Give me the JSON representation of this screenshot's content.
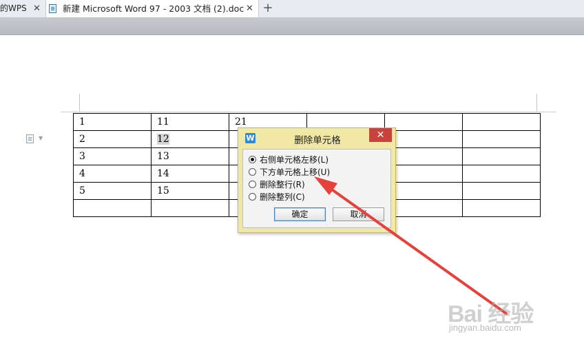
{
  "tabs": {
    "prev_label": "的WPS",
    "active_label": "新建 Microsoft Word 97 - 2003 文档 (2).doc",
    "close_glyph": "✕",
    "new_tab_glyph": "+"
  },
  "table": {
    "rows": [
      [
        "1",
        "11",
        "21",
        "",
        "",
        ""
      ],
      [
        "2",
        "12",
        "",
        "",
        "",
        ""
      ],
      [
        "3",
        "13",
        "",
        "",
        "",
        ""
      ],
      [
        "4",
        "14",
        "",
        "",
        "",
        ""
      ],
      [
        "5",
        "15",
        "",
        "",
        "",
        ""
      ],
      [
        "",
        "",
        "",
        "",
        "",
        ""
      ]
    ],
    "highlighted_cell": "12"
  },
  "dialog": {
    "title": "删除单元格",
    "app_icon": "W",
    "close_glyph": "✕",
    "options": [
      {
        "label": "右侧单元格左移(L)",
        "selected": true
      },
      {
        "label": "下方单元格上移(U)",
        "selected": false
      },
      {
        "label": "删除整行(R)",
        "selected": false
      },
      {
        "label": "删除整列(C)",
        "selected": false
      }
    ],
    "ok_label": "确定",
    "cancel_label": "取消"
  },
  "watermark": {
    "logo": "Bai 经验",
    "url": "jingyan.baidu.com"
  },
  "colors": {
    "dialog_bg": "#f1e8a6",
    "close_red": "#c7443d",
    "arrow_red": "#e8403a"
  }
}
